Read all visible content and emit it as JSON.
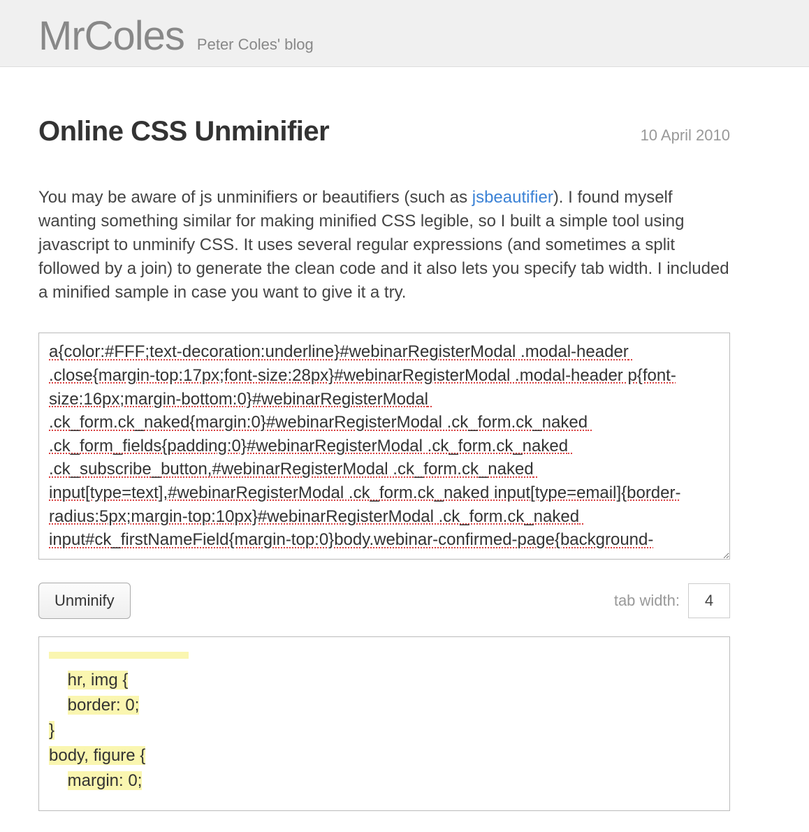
{
  "header": {
    "site_title": "MrColes",
    "site_subtitle": "Peter Coles' blog"
  },
  "post": {
    "title": "Online CSS Unminifier",
    "date": "10 April 2010",
    "intro_before_link": "You may be aware of js unminifiers or beautifiers (such as ",
    "intro_link": "jsbeautifier",
    "intro_after_link": "). I found myself wanting something similar for making minified CSS legible, so I built a simple tool using javascript to unminify CSS. It uses several regular expressions (and sometimes a split followed by a join) to generate the clean code and it also lets you specify tab width. I included a minified sample in case you want to give it a try."
  },
  "input": {
    "css_text": "a{color:#FFF;text-decoration:underline}#webinarRegisterModal .modal-header .close{margin-top:17px;font-size:28px}#webinarRegisterModal .modal-header p{font-size:16px;margin-bottom:0}#webinarRegisterModal .ck_form.ck_naked{margin:0}#webinarRegisterModal .ck_form.ck_naked .ck_form_fields{padding:0}#webinarRegisterModal .ck_form.ck_naked .ck_subscribe_button,#webinarRegisterModal .ck_form.ck_naked input[type=text],#webinarRegisterModal .ck_form.ck_naked input[type=email]{border-radius:5px;margin-top:10px}#webinarRegisterModal .ck_form.ck_naked input#ck_firstNameField{margin-top:0}body.webinar-confirmed-page{background-"
  },
  "controls": {
    "unminify_label": "Unminify",
    "tab_width_label": "tab width:",
    "tab_width_value": "4"
  },
  "output": {
    "line1_indent": "    ",
    "line1_text": "hr, img {",
    "line2_indent": "    ",
    "line2_text": "border: 0;",
    "line3_text": "}",
    "line4_text": "body, figure {",
    "line5_indent": "    ",
    "line5_text": "margin: 0;"
  }
}
